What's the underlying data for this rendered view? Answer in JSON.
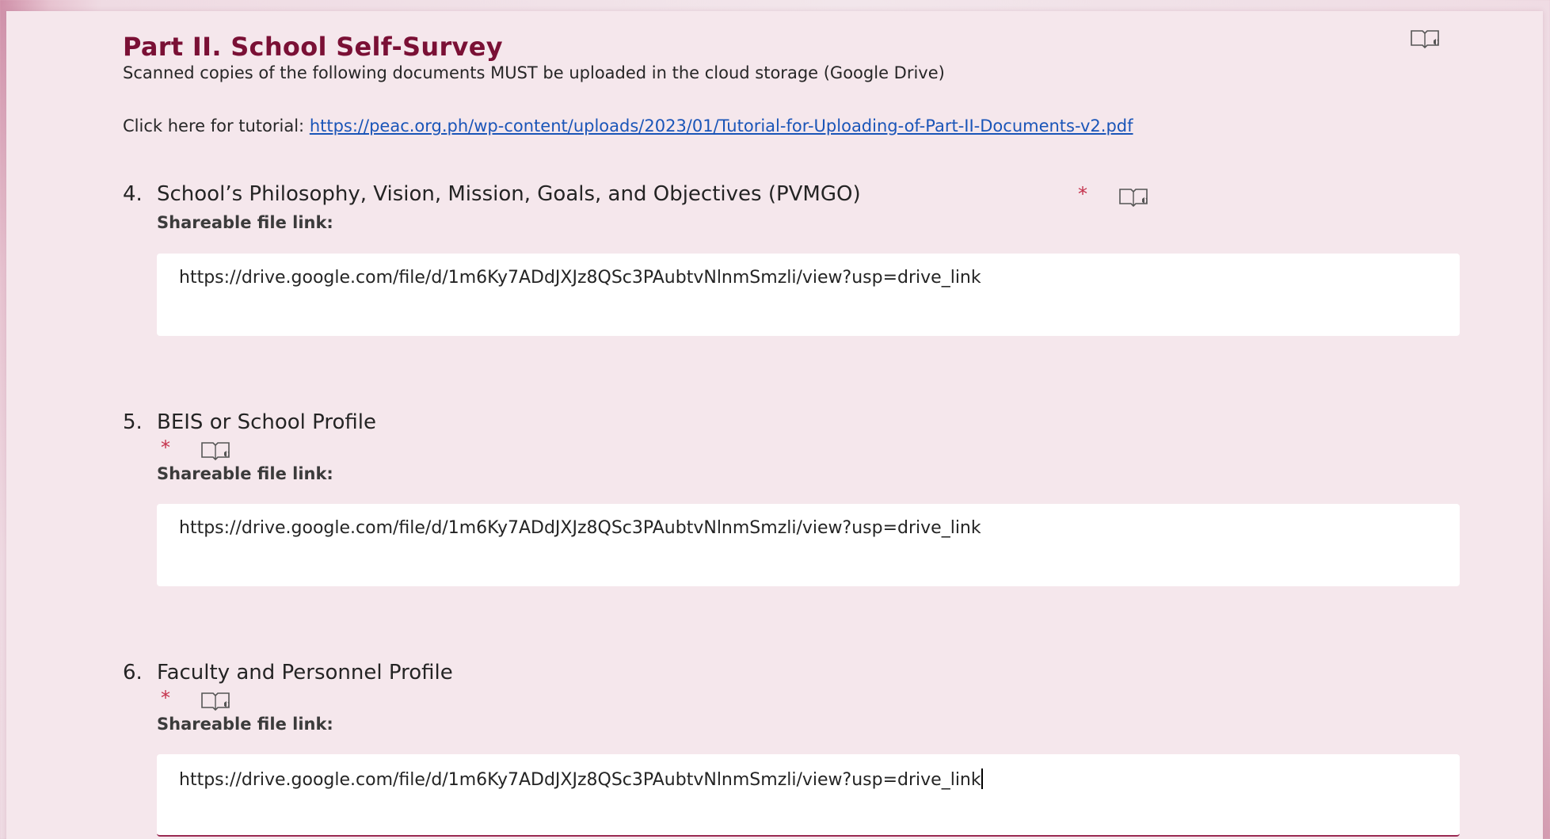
{
  "section": {
    "title": "Part II. School Self-Survey",
    "description": "Scanned copies of the following documents MUST be uploaded in the cloud storage (Google Drive)",
    "tutorial_prefix": "Click here for tutorial: ",
    "tutorial_link": "https://peac.org.ph/wp-content/uploads/2023/01/Tutorial-for-Uploading-of-Part-II-Documents-v2.pdf"
  },
  "questions": [
    {
      "number": "4.",
      "title": "School’s Philosophy, Vision, Mission, Goals, and Objectives (PVMGO)",
      "required_mark": "*",
      "subtitle": "Shareable file link:",
      "answer": "https://drive.google.com/file/d/1m6Ky7ADdJXJz8QSc3PAubtvNlnmSmzli/view?usp=drive_link"
    },
    {
      "number": "5.",
      "title": "BEIS or School Profile",
      "required_mark": "*",
      "subtitle": "Shareable file link:",
      "answer": "https://drive.google.com/file/d/1m6Ky7ADdJXJz8QSc3PAubtvNlnmSmzli/view?usp=drive_link"
    },
    {
      "number": "6.",
      "title": "Faculty and Personnel Profile",
      "required_mark": "*",
      "subtitle": "Shareable file link:",
      "answer": "https://drive.google.com/file/d/1m6Ky7ADdJXJz8QSc3PAubtvNlnmSmzli/view?usp=drive_link"
    }
  ],
  "icons": {
    "immersive_reader": "immersive-reader-icon"
  },
  "colors": {
    "title": "#7a1035",
    "link": "#1a55b8",
    "required": "#c4314b",
    "card": "#f5e7ec",
    "background_accent": "#cf8fa8"
  }
}
